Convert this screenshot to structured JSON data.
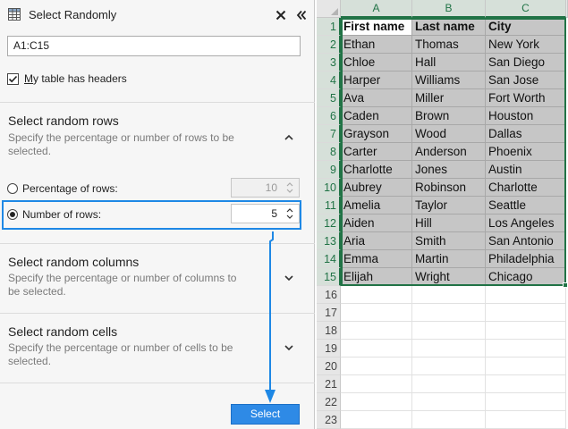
{
  "pane": {
    "title": "Select Randomly",
    "close_icon": "close-icon",
    "collapse_icon": "double-chevron-left-icon",
    "range_value": "A1:C15",
    "headers_checkbox": {
      "label": "My table has headers",
      "checked": true
    }
  },
  "rows_section": {
    "title": "Select random rows",
    "description": "Specify the percentage or number of rows to be selected.",
    "expanded": true,
    "percentage_label": "Percentage of rows:",
    "percentage_value": "10",
    "number_label": "Number of rows:",
    "number_value": "5",
    "selected_option": "number"
  },
  "columns_section": {
    "title": "Select random columns",
    "description": "Specify the percentage or number of columns to be selected.",
    "expanded": false
  },
  "cells_section": {
    "title": "Select random cells",
    "description": "Specify the percentage or number of cells to be selected.",
    "expanded": false
  },
  "select_button": "Select",
  "colors": {
    "accent": "#2e8ae6",
    "highlight": "#1e88e5",
    "excel_green": "#217346"
  },
  "sheet": {
    "columns": [
      "A",
      "B",
      "C"
    ],
    "row_numbers": [
      "1",
      "2",
      "3",
      "4",
      "5",
      "6",
      "7",
      "8",
      "9",
      "10",
      "11",
      "12",
      "13",
      "14",
      "15",
      "16",
      "17",
      "18",
      "19",
      "20",
      "21",
      "22",
      "23"
    ],
    "headers": [
      "First name",
      "Last name",
      "City"
    ],
    "rows": [
      [
        "Ethan",
        "Thomas",
        "New York"
      ],
      [
        "Chloe",
        "Hall",
        "San Diego"
      ],
      [
        "Harper",
        "Williams",
        "San Jose"
      ],
      [
        "Ava",
        "Miller",
        "Fort Worth"
      ],
      [
        "Caden",
        "Brown",
        "Houston"
      ],
      [
        "Grayson",
        "Wood",
        "Dallas"
      ],
      [
        "Carter",
        "Anderson",
        "Phoenix"
      ],
      [
        "Charlotte",
        "Jones",
        "Austin"
      ],
      [
        "Aubrey",
        "Robinson",
        "Charlotte"
      ],
      [
        "Amelia",
        "Taylor",
        "Seattle"
      ],
      [
        "Aiden",
        "Hill",
        "Los Angeles"
      ],
      [
        "Aria",
        "Smith",
        "San Antonio"
      ],
      [
        "Emma",
        "Martin",
        "Philadelphia"
      ],
      [
        "Elijah",
        "Wright",
        "Chicago"
      ]
    ]
  }
}
